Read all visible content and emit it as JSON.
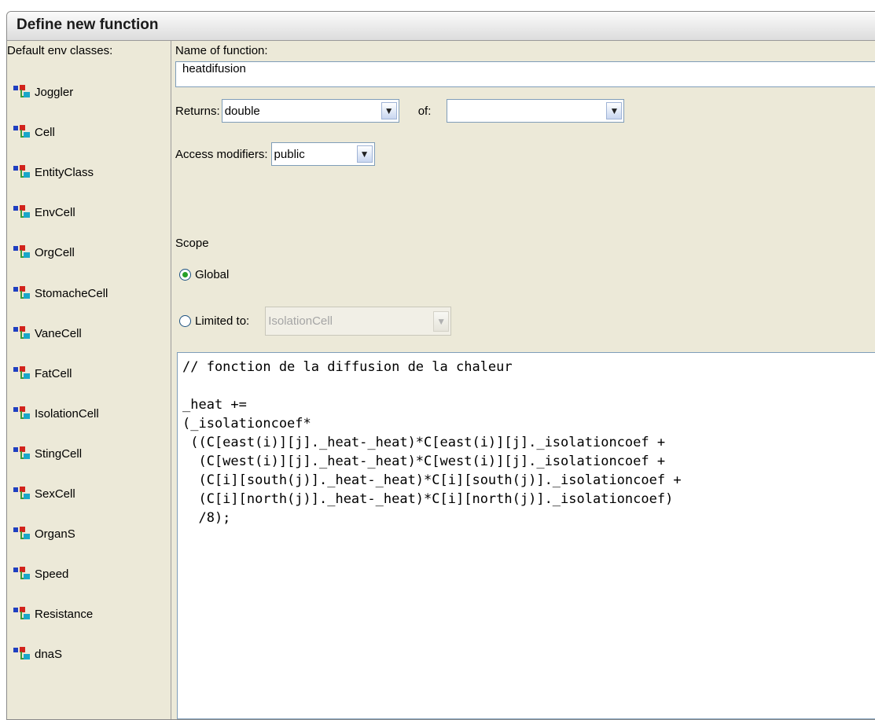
{
  "window": {
    "title": "Define new function"
  },
  "sidebar": {
    "header": "Default env classes:",
    "items": [
      {
        "label": "Joggler"
      },
      {
        "label": "Cell"
      },
      {
        "label": "EntityClass"
      },
      {
        "label": "EnvCell"
      },
      {
        "label": "OrgCell"
      },
      {
        "label": "StomacheCell"
      },
      {
        "label": "VaneCell"
      },
      {
        "label": "FatCell"
      },
      {
        "label": "IsolationCell"
      },
      {
        "label": "StingCell"
      },
      {
        "label": "SexCell"
      },
      {
        "label": "OrganS"
      },
      {
        "label": "Speed"
      },
      {
        "label": "Resistance"
      },
      {
        "label": "dnaS"
      }
    ],
    "item_icon": "class-icon"
  },
  "form": {
    "name_label": "Name of function:",
    "name_value": "heatdifusion",
    "returns_label": "Returns:",
    "returns_value": "double",
    "of_label": "of:",
    "of_value": "",
    "access_label": "Access modifiers:",
    "access_value": "public",
    "scope_label": "Scope",
    "scope_global_label": "Global",
    "scope_limited_label": "Limited to:",
    "scope_limited_value": "IsolationCell",
    "scope_selected": "Global",
    "dropdown_icon": "chevron-down-icon"
  },
  "code": {
    "text": "// fonction de la diffusion de la chaleur\n\n_heat +=\n(_isolationcoef*\n ((C[east(i)][j]._heat-_heat)*C[east(i)][j]._isolationcoef +\n  (C[west(i)][j]._heat-_heat)*C[west(i)][j]._isolationcoef +\n  (C[i][south(j)]._heat-_heat)*C[i][south(j)]._isolationcoef +\n  (C[i][north(j)]._heat-_heat)*C[i][north(j)]._isolationcoef)\n  /8);"
  }
}
